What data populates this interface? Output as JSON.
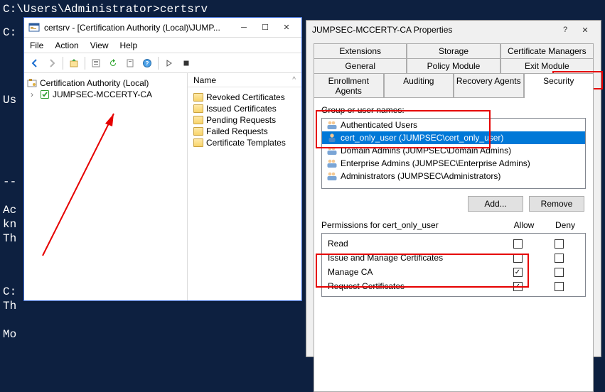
{
  "console": {
    "prompt": "C:\\Users\\Administrator>certsrv",
    "bg_fragments": [
      "C:",
      "Us",
      "--",
      "Ac",
      "kn",
      "Th",
      "C:",
      "Th",
      "Mo"
    ]
  },
  "mmc": {
    "title": "certsrv - [Certification Authority (Local)\\JUMP...",
    "menu": [
      "File",
      "Action",
      "View",
      "Help"
    ],
    "tree": {
      "root": "Certification Authority (Local)",
      "child": "JUMPSEC-MCCERTY-CA"
    },
    "list": {
      "header": "Name",
      "items": [
        "Revoked Certificates",
        "Issued Certificates",
        "Pending Requests",
        "Failed Requests",
        "Certificate Templates"
      ]
    }
  },
  "props": {
    "title": "JUMPSEC-MCCERTY-CA Properties",
    "tabs_row1": [
      "Extensions",
      "Storage",
      "Certificate Managers"
    ],
    "tabs_row2": [
      "General",
      "Policy Module",
      "Exit Module"
    ],
    "tabs_row3": [
      "Enrollment Agents",
      "Auditing",
      "Recovery Agents",
      "Security"
    ],
    "group_label": "Group or user names:",
    "principals": [
      {
        "label": "Authenticated Users",
        "type": "group"
      },
      {
        "label": "cert_only_user (JUMPSEC\\cert_only_user)",
        "type": "user",
        "selected": true
      },
      {
        "label": "Domain Admins (JUMPSEC\\Domain Admins)",
        "type": "group"
      },
      {
        "label": "Enterprise Admins (JUMPSEC\\Enterprise Admins)",
        "type": "group"
      },
      {
        "label": "Administrators (JUMPSEC\\Administrators)",
        "type": "group"
      }
    ],
    "add_btn": "Add...",
    "remove_btn": "Remove",
    "perm_label": "Permissions for cert_only_user",
    "allow_label": "Allow",
    "deny_label": "Deny",
    "perms": [
      {
        "name": "Read",
        "allow": false,
        "deny": false
      },
      {
        "name": "Issue and Manage Certificates",
        "allow": false,
        "deny": false
      },
      {
        "name": "Manage CA",
        "allow": true,
        "deny": false
      },
      {
        "name": "Request Certificates",
        "allow": true,
        "deny": false
      }
    ]
  }
}
